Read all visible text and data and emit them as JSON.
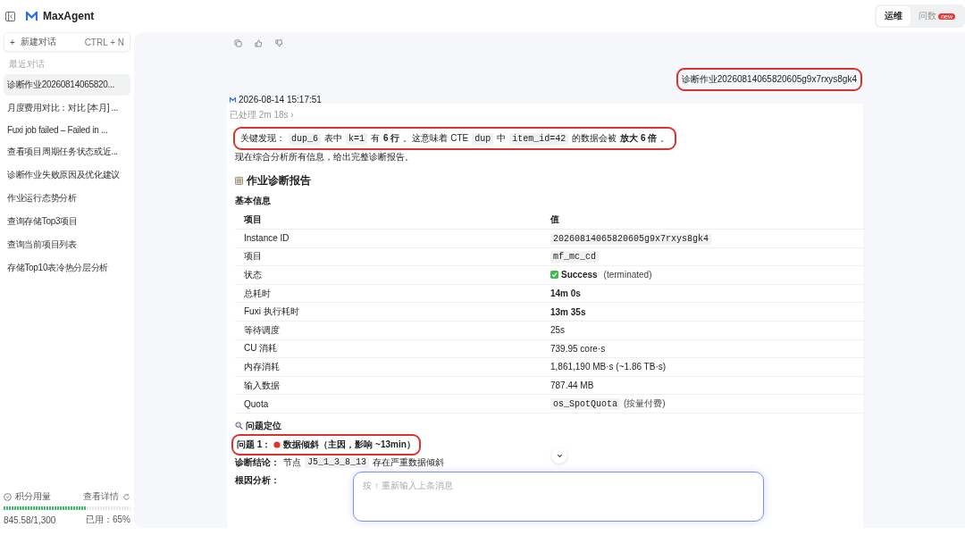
{
  "app": {
    "name": "MaxAgent"
  },
  "new_chat": {
    "icon": "+",
    "label": "新建对话",
    "shortcut": "CTRL + N"
  },
  "recent": {
    "heading": "最近对话",
    "items": [
      {
        "label": "诊断作业20260814065820...",
        "selected": true
      },
      {
        "label": "月度费用对比：对比 [本月] ...",
        "selected": false
      },
      {
        "label": "Fuxi job failed – Failed in ...",
        "selected": false
      },
      {
        "label": "查看项目周期任务状态或近...",
        "selected": false
      },
      {
        "label": "诊断作业失败原因及优化建议",
        "selected": false
      },
      {
        "label": "作业运行态势分析",
        "selected": false
      },
      {
        "label": "查询存储Top3项目",
        "selected": false
      },
      {
        "label": "查询当前项目列表",
        "selected": false
      },
      {
        "label": "存储Top10表冷热分层分析",
        "selected": false
      }
    ]
  },
  "credits": {
    "title": "积分用量",
    "details_link": "查看详情",
    "level": 0.65,
    "amount": "845.58/1,300",
    "used": "已用：65%"
  },
  "mode_tabs": [
    {
      "label": "运维",
      "selected": true
    },
    {
      "label": "问数",
      "selected": false,
      "badge": "new"
    }
  ],
  "user_message": {
    "text": "诊断作业20260814065820605g9x7rxys8gk4",
    "highlighted": true
  },
  "reply": {
    "timestamp": "2026-08-14 15:17:51",
    "processed": "已处理 2m 18s ›",
    "key_finding": {
      "highlighted": true,
      "segments": [
        {
          "kind": "text",
          "text": "关键发现："
        },
        {
          "kind": "code",
          "text": "dup_6"
        },
        {
          "kind": "text",
          "text": "表中"
        },
        {
          "kind": "code",
          "text": "k=1"
        },
        {
          "kind": "text",
          "text": "有"
        },
        {
          "kind": "bold",
          "text": "6 行"
        },
        {
          "kind": "text",
          "text": "。这意味着 CTE"
        },
        {
          "kind": "code",
          "text": "dup"
        },
        {
          "kind": "text",
          "text": "中"
        },
        {
          "kind": "code",
          "text": "item_id=42"
        },
        {
          "kind": "text",
          "text": "的数据会被"
        },
        {
          "kind": "bold",
          "text": "放大 6 倍"
        },
        {
          "kind": "text",
          "text": "。"
        }
      ]
    },
    "summary": "现在综合分析所有信息，给出完整诊断报告。",
    "report_title": "作业诊断报告",
    "basic_info_heading": "基本信息",
    "table": {
      "columns": [
        "项目",
        "值"
      ],
      "rows": [
        {
          "label": "Instance ID",
          "kind": "code",
          "value": "20260814065820605g9x7rxys8gk4"
        },
        {
          "label": "项目",
          "kind": "code",
          "value": "mf_mc_cd"
        },
        {
          "label": "状态",
          "kind": "status",
          "value": "Success",
          "note": "(terminated)"
        },
        {
          "label": "总耗时",
          "kind": "bold",
          "value": "14m 0s"
        },
        {
          "label": "Fuxi 执行耗时",
          "kind": "bold",
          "value": "13m 35s"
        },
        {
          "label": "等待调度",
          "kind": "plain",
          "value": "25s"
        },
        {
          "label": "CU 消耗",
          "kind": "plain",
          "value": "739.95 core·s"
        },
        {
          "label": "内存消耗",
          "kind": "plain",
          "value": "1,861,190 MB·s (~1.86 TB·s)"
        },
        {
          "label": "输入数据",
          "kind": "plain",
          "value": "787.44 MB"
        },
        {
          "label": "Quota",
          "kind": "code",
          "value": "os_SpotQuota",
          "note": "(按量付费)"
        }
      ]
    },
    "issues_heading": "问题定位",
    "issue": {
      "label": "问题 1：",
      "title": "数据倾斜（主因，影响 ~13min）",
      "highlighted": true
    },
    "conclusion": [
      {
        "kind": "bold",
        "text": "诊断结论："
      },
      {
        "kind": "text",
        "text": "节点"
      },
      {
        "kind": "code",
        "text": "J5_1_3_8_13"
      },
      {
        "kind": "text",
        "text": "存在严重数据倾斜"
      }
    ],
    "root_cause": "根因分析："
  },
  "input": {
    "placeholder": "按 ↑ 重新输入上条消息"
  }
}
